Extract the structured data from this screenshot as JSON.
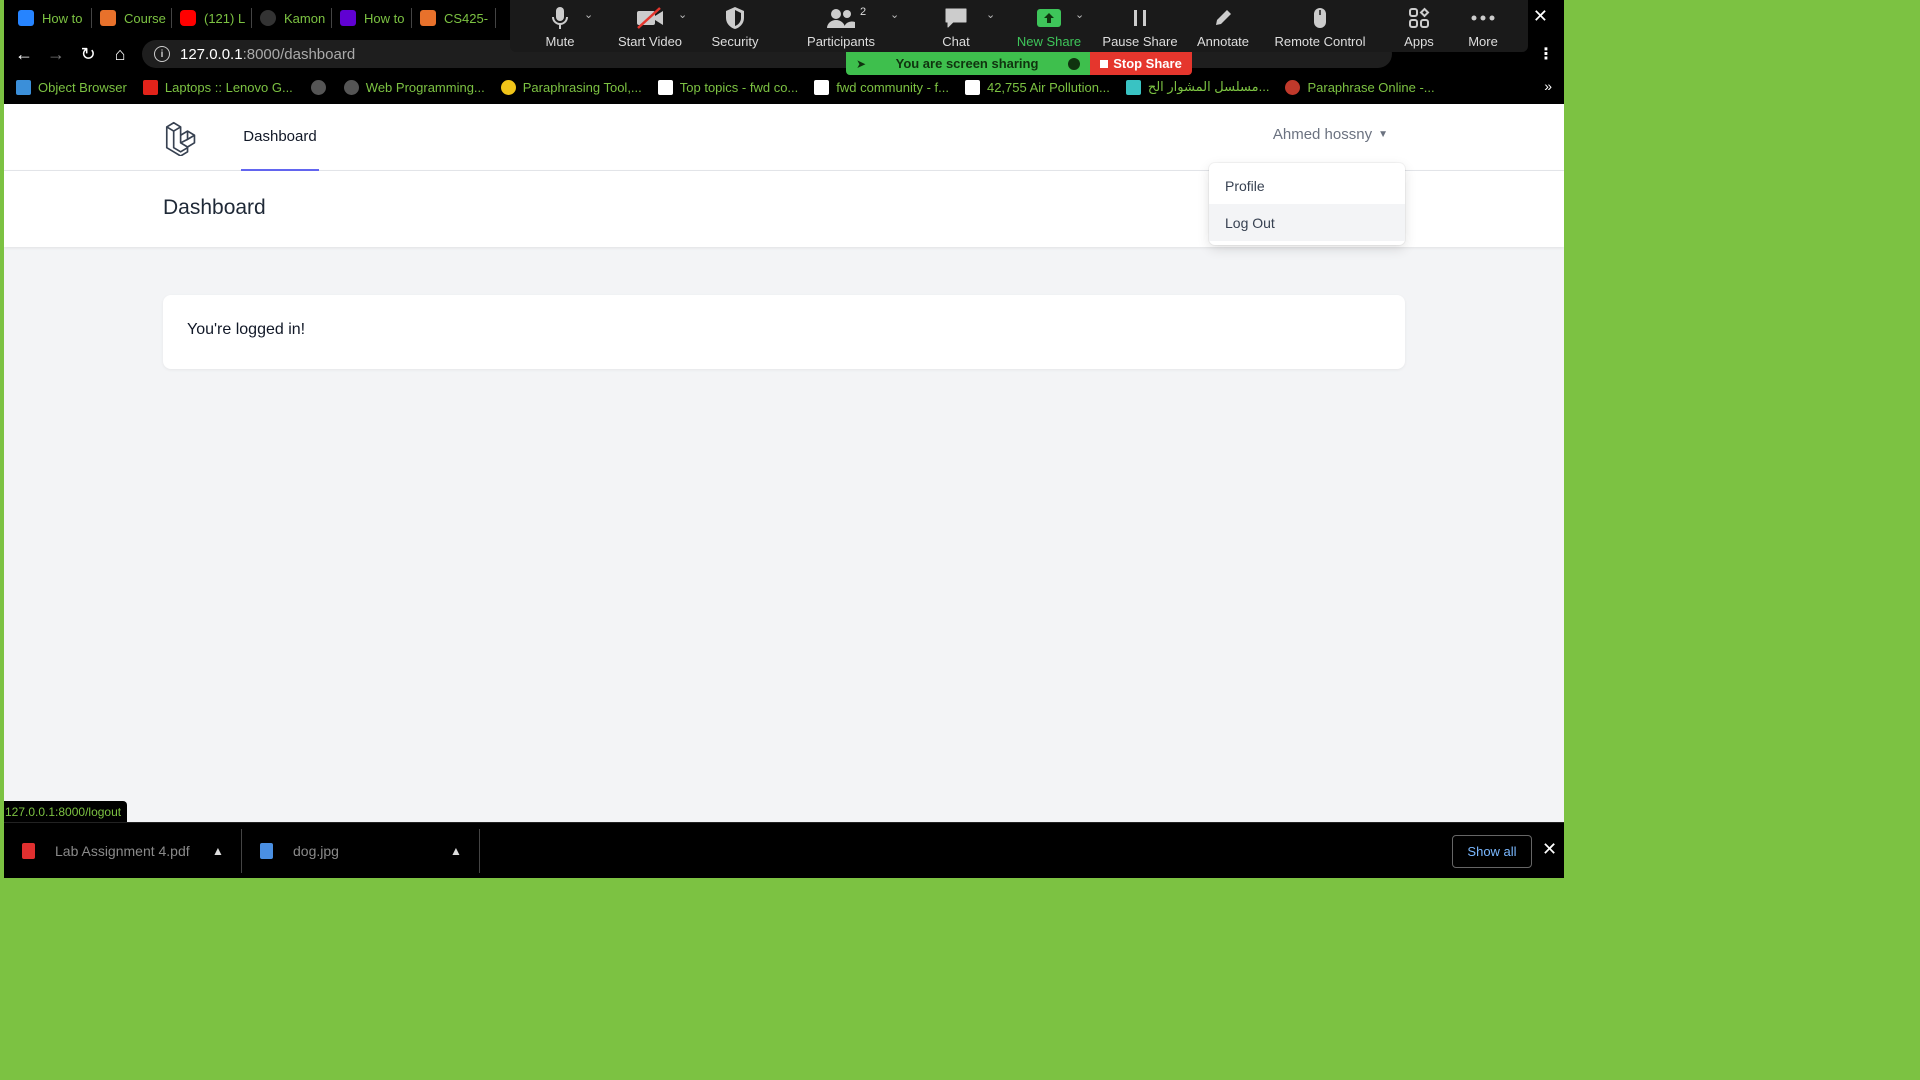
{
  "browser": {
    "tabs": [
      {
        "label": "How to",
        "icon": "confluence-icon",
        "color": "#2684ff"
      },
      {
        "label": "Course",
        "icon": "coursera-icon",
        "color": "#e8712b"
      },
      {
        "label": "(121) L",
        "icon": "youtube-icon",
        "color": "#ff0000"
      },
      {
        "label": "Kamon",
        "icon": "github-icon",
        "color": "#333333"
      },
      {
        "label": "How to",
        "icon": "yahoo-icon",
        "color": "#6001d2"
      },
      {
        "label": "CS425-",
        "icon": "moodle-icon",
        "color": "#e8712b"
      }
    ],
    "url_host": "127.0.0.1",
    "url_path": ":8000/dashboard",
    "bookmarks": [
      {
        "label": "Object Browser",
        "icon": "object-browser-icon",
        "color": "#3b8fd9"
      },
      {
        "label": "Laptops :: Lenovo G...",
        "icon": "lenovo-icon",
        "color": "#e2231a"
      },
      {
        "label": "",
        "icon": "globe-icon",
        "color": "#666666"
      },
      {
        "label": "Web Programming...",
        "icon": "globe-icon",
        "color": "#666666"
      },
      {
        "label": "Paraphrasing Tool,...",
        "icon": "magnifier-icon",
        "color": "#f0c419"
      },
      {
        "label": "Top topics - fwd co...",
        "icon": "forum-icon",
        "color": "#ffffff"
      },
      {
        "label": "fwd community - f...",
        "icon": "forum-icon",
        "color": "#ffffff"
      },
      {
        "label": "42,755 Air Pollution...",
        "icon": "istock-icon",
        "color": "#ffffff"
      },
      {
        "label": "مسلسل المشوار الح...",
        "icon": "film-icon",
        "color": "#39c3c3"
      },
      {
        "label": "Paraphrase Online -...",
        "icon": "paraphrase-icon",
        "color": "#c0392b"
      }
    ],
    "status_url": "127.0.0.1:8000/logout"
  },
  "zoom": {
    "buttons": [
      {
        "label": "Mute",
        "icon": "microphone-icon"
      },
      {
        "label": "Start Video",
        "icon": "video-off-icon"
      },
      {
        "label": "Security",
        "icon": "shield-icon"
      },
      {
        "label": "Participants",
        "icon": "participants-icon"
      },
      {
        "label": "Chat",
        "icon": "chat-icon"
      },
      {
        "label": "New Share",
        "icon": "share-screen-icon"
      },
      {
        "label": "Pause Share",
        "icon": "pause-icon"
      },
      {
        "label": "Annotate",
        "icon": "pencil-icon"
      },
      {
        "label": "Remote Control",
        "icon": "mouse-icon"
      },
      {
        "label": "Apps",
        "icon": "apps-icon"
      },
      {
        "label": "More",
        "icon": "more-icon"
      }
    ],
    "participant_count": "2",
    "sharing_text": "You are screen sharing",
    "stop_share": "Stop Share",
    "accent": "#3ebf4d",
    "stop_color": "#e5362d"
  },
  "app": {
    "nav_link": "Dashboard",
    "user_name": "Ahmed hossny",
    "dropdown": [
      "Profile",
      "Log Out"
    ],
    "page_title": "Dashboard",
    "message": "You're logged in!",
    "accent": "#6366f1"
  },
  "downloads": {
    "items": [
      {
        "name": "Lab Assignment 4.pdf",
        "icon": "pdf-file-icon"
      },
      {
        "name": "dog.jpg",
        "icon": "image-file-icon"
      }
    ],
    "show_all": "Show all"
  }
}
